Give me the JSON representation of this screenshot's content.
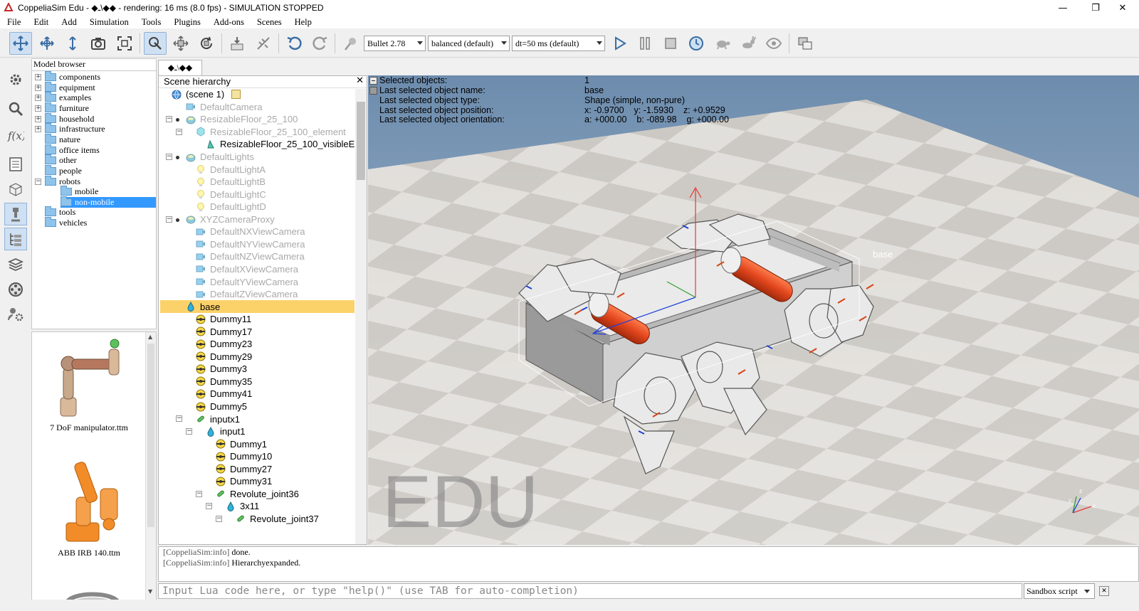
{
  "window": {
    "title": "CoppeliaSim Edu - ◆ـ\\◆◆ - rendering: 16 ms (8.0 fps) - SIMULATION STOPPED",
    "minimize": "—",
    "maximize": "❐",
    "close": "✕"
  },
  "menu": [
    "File",
    "Edit",
    "Add",
    "Simulation",
    "Tools",
    "Plugins",
    "Add-ons",
    "Scenes",
    "Help"
  ],
  "toolbar": {
    "physics_engine": "Bullet 2.78",
    "accuracy": "balanced (default)",
    "timestep": "dt=50 ms (default)"
  },
  "model_browser": {
    "header": "Model browser",
    "items": [
      {
        "label": "components",
        "expander": "+"
      },
      {
        "label": "equipment",
        "expander": "+"
      },
      {
        "label": "examples",
        "expander": "+"
      },
      {
        "label": "furniture",
        "expander": "+"
      },
      {
        "label": "household",
        "expander": "+"
      },
      {
        "label": "infrastructure",
        "expander": "+"
      },
      {
        "label": "nature",
        "expander": ""
      },
      {
        "label": "office items",
        "expander": ""
      },
      {
        "label": "other",
        "expander": ""
      },
      {
        "label": "people",
        "expander": ""
      },
      {
        "label": "robots",
        "expander": "−"
      },
      {
        "label": "mobile",
        "expander": ""
      },
      {
        "label": "non-mobile",
        "expander": ""
      },
      {
        "label": "tools",
        "expander": ""
      },
      {
        "label": "vehicles",
        "expander": ""
      }
    ],
    "thumbnails": [
      {
        "caption": "7 DoF manipulator.ttm"
      },
      {
        "caption": "ABB IRB 140.ttm"
      }
    ]
  },
  "scene_tab": "◆ـ\\◆◆",
  "hierarchy": {
    "header": "Scene hierarchy",
    "close": "✕",
    "rows": [
      {
        "label": "(scene 1)",
        "icon": "globe"
      },
      {
        "label": "DefaultCamera",
        "icon": "camera"
      },
      {
        "label": "ResizableFloor_25_100",
        "icon": "shape",
        "expander": "−"
      },
      {
        "label": "ResizableFloor_25_100_element",
        "icon": "cube",
        "expander": "−"
      },
      {
        "label": "ResizableFloor_25_100_visibleE",
        "icon": "shape2"
      },
      {
        "label": "DefaultLights",
        "icon": "shape",
        "expander": "−"
      },
      {
        "label": "DefaultLightA",
        "icon": "light"
      },
      {
        "label": "DefaultLightB",
        "icon": "light"
      },
      {
        "label": "DefaultLightC",
        "icon": "light"
      },
      {
        "label": "DefaultLightD",
        "icon": "light"
      },
      {
        "label": "XYZCameraProxy",
        "icon": "shape",
        "expander": "−"
      },
      {
        "label": "DefaultNXViewCamera",
        "icon": "camera"
      },
      {
        "label": "DefaultNYViewCamera",
        "icon": "camera"
      },
      {
        "label": "DefaultNZViewCamera",
        "icon": "camera"
      },
      {
        "label": "DefaultXViewCamera",
        "icon": "camera"
      },
      {
        "label": "DefaultYViewCamera",
        "icon": "camera"
      },
      {
        "label": "DefaultZViewCamera",
        "icon": "camera"
      },
      {
        "label": "base",
        "icon": "drop",
        "expander": "−"
      },
      {
        "label": "Dummy11",
        "icon": "dummy"
      },
      {
        "label": "Dummy17",
        "icon": "dummy"
      },
      {
        "label": "Dummy23",
        "icon": "dummy"
      },
      {
        "label": "Dummy29",
        "icon": "dummy"
      },
      {
        "label": "Dummy3",
        "icon": "dummy"
      },
      {
        "label": "Dummy35",
        "icon": "dummy"
      },
      {
        "label": "Dummy41",
        "icon": "dummy"
      },
      {
        "label": "Dummy5",
        "icon": "dummy"
      },
      {
        "label": "inputx1",
        "icon": "joint",
        "expander": "−"
      },
      {
        "label": "input1",
        "icon": "drop",
        "expander": "−"
      },
      {
        "label": "Dummy1",
        "icon": "dummy"
      },
      {
        "label": "Dummy10",
        "icon": "dummy"
      },
      {
        "label": "Dummy27",
        "icon": "dummy"
      },
      {
        "label": "Dummy31",
        "icon": "dummy"
      },
      {
        "label": "Revolute_joint36",
        "icon": "joint",
        "expander": "−"
      },
      {
        "label": "3x11",
        "icon": "drop",
        "expander": "−"
      },
      {
        "label": "Revolute_joint37",
        "icon": "joint",
        "expander": "−"
      }
    ]
  },
  "selection_info": [
    {
      "key": "Selected objects:",
      "value": "1"
    },
    {
      "key": "Last selected object name:",
      "value": "base"
    },
    {
      "key": "Last selected object type:",
      "value": "Shape (simple, non-pure)"
    },
    {
      "key": "Last selected object position:",
      "value": "x: -0.9700    y: -1.5930    z: +0.9529"
    },
    {
      "key": "Last selected object orientation:",
      "value": "a: +000.00    b: -089.98    g: +000.00"
    }
  ],
  "viewport": {
    "watermark": "EDU",
    "object_label": "base",
    "axis_x": "x",
    "axis_y": "y",
    "axis_z": "z"
  },
  "console": [
    {
      "source": "[CoppeliaSim:info]",
      "text": "done."
    },
    {
      "source": "[CoppeliaSim:info]",
      "text": "Hierarchyexpanded."
    }
  ],
  "lua_input": {
    "placeholder": "Input Lua code here, or type \"help()\" (use TAB for auto-completion)"
  },
  "script_select": "Sandbox script"
}
